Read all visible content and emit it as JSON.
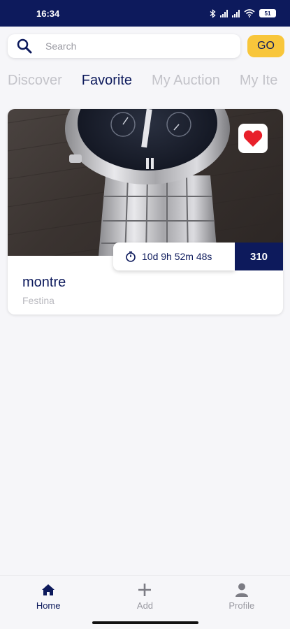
{
  "status_bar": {
    "time": "16:34",
    "battery": "51"
  },
  "search": {
    "placeholder": "Search",
    "go_label": "GO"
  },
  "tabs": [
    {
      "label": "Discover"
    },
    {
      "label": "Favorite"
    },
    {
      "label": "My Auction"
    },
    {
      "label": "My Ite"
    }
  ],
  "item": {
    "title": "montre",
    "brand": "Festina",
    "countdown": "10d 9h 52m 48s",
    "bids": "310",
    "favorite": true
  },
  "bottom_nav": [
    {
      "label": "Home"
    },
    {
      "label": "Add"
    },
    {
      "label": "Profile"
    }
  ],
  "colors": {
    "primary": "#0d1a5c",
    "accent": "#f8c63b",
    "heart": "#e8202a"
  }
}
